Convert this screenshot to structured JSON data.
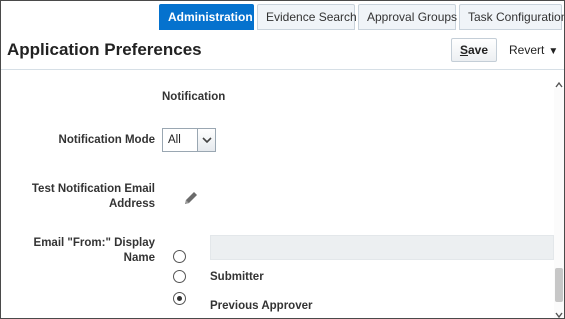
{
  "tabs": [
    {
      "label": "Administration",
      "active": true
    },
    {
      "label": "Evidence Search",
      "active": false
    },
    {
      "label": "Approval Groups",
      "active": false
    },
    {
      "label": "Task Configuration",
      "active": false
    }
  ],
  "header": {
    "title": "Application Preferences",
    "save_prefix": "",
    "save_mnemonic": "S",
    "save_suffix": "ave",
    "revert_label": "Revert"
  },
  "form": {
    "section_label": "Notification",
    "notification_mode": {
      "label": "Notification Mode",
      "value": "All"
    },
    "test_email": {
      "label": "Test Notification Email Address"
    },
    "email_from": {
      "label": "Email \"From:\" Display Name",
      "value": "",
      "options": [
        {
          "label": "",
          "selected": false
        },
        {
          "label": "Submitter",
          "selected": false
        },
        {
          "label": "Previous Approver",
          "selected": true
        }
      ]
    }
  },
  "colors": {
    "accent": "#0572ce",
    "tab_bg": "#f0f4f8",
    "input_disabled": "#eceff1"
  },
  "icons": {
    "edit": "pencil-icon",
    "dropdown": "chevron-down-icon",
    "revert_menu": "caret-down-icon"
  }
}
